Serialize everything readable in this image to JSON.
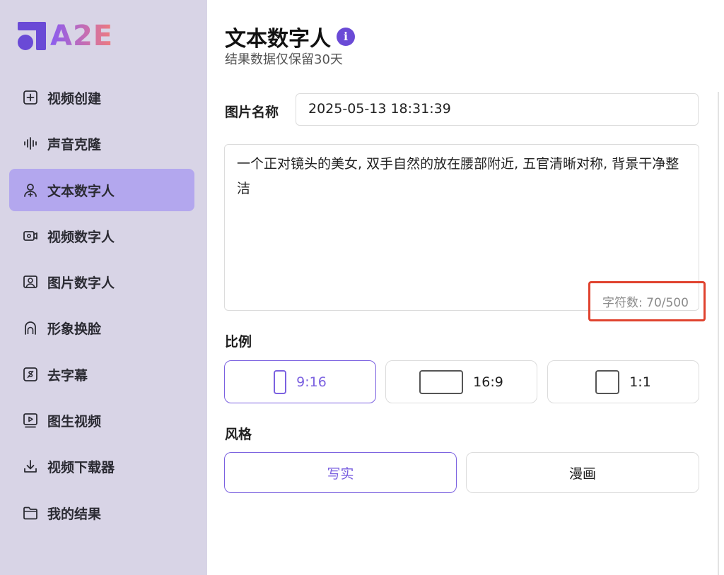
{
  "brand": {
    "logo_text": "A2E"
  },
  "sidebar": {
    "items": [
      {
        "label": "视频创建",
        "icon": "plus-square-icon"
      },
      {
        "label": "声音克隆",
        "icon": "waveform-icon"
      },
      {
        "label": "文本数字人",
        "icon": "user-add-icon",
        "active": true
      },
      {
        "label": "视频数字人",
        "icon": "video-camera-icon"
      },
      {
        "label": "图片数字人",
        "icon": "portrait-icon"
      },
      {
        "label": "形象换脸",
        "icon": "face-icon"
      },
      {
        "label": "去字幕",
        "icon": "subtitle-remove-icon"
      },
      {
        "label": "图生视频",
        "icon": "play-video-icon"
      },
      {
        "label": "视频下载器",
        "icon": "download-icon"
      },
      {
        "label": "我的结果",
        "icon": "folder-icon"
      }
    ]
  },
  "header": {
    "title": "文本数字人",
    "info_icon": "i",
    "subtitle": "结果数据仅保留30天"
  },
  "form": {
    "name_label": "图片名称",
    "name_value": "2025-05-13 18:31:39",
    "prompt_value": "一个正对镜头的美女, 双手自然的放在腰部附近, 五官清晰对称, 背景干净整洁",
    "char_count": "字符数: 70/500",
    "ratio_label": "比例",
    "ratios": [
      {
        "label": "9:16",
        "selected": true
      },
      {
        "label": "16:9",
        "selected": false
      },
      {
        "label": "1:1",
        "selected": false
      }
    ],
    "style_label": "风格",
    "styles": [
      {
        "label": "写实",
        "selected": true
      },
      {
        "label": "漫画",
        "selected": false
      }
    ]
  },
  "colors": {
    "accent": "#7b61e0",
    "sidebar_bg": "#d8d4e6",
    "active_item_bg": "#b3a7ee",
    "highlight_box": "#e0432f"
  }
}
